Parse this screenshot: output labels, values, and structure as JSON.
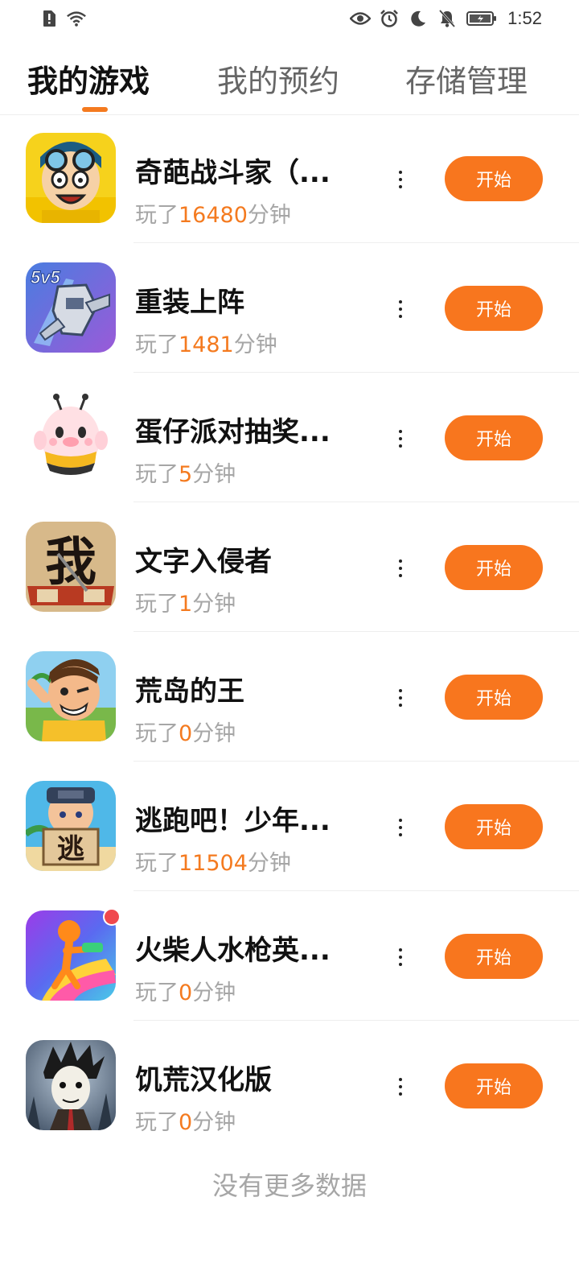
{
  "status_bar": {
    "time": "1:52",
    "left_icons": [
      "alert-sim-icon",
      "wifi-icon"
    ],
    "right_icons": [
      "eye-comfort-icon",
      "alarm-icon",
      "moon-icon",
      "mute-bell-icon",
      "battery-charging-icon"
    ]
  },
  "tabs": [
    {
      "label": "我的游戏",
      "active": true
    },
    {
      "label": "我的预约",
      "active": false
    },
    {
      "label": "存储管理",
      "active": false
    }
  ],
  "accent_color": "#f47a1f",
  "games": [
    {
      "title": "奇葩战斗家（...",
      "played_prefix": "玩了",
      "minutes": "16480",
      "played_suffix": "分钟",
      "button": "开始",
      "icon": "cartoon-boy-goggles-icon",
      "has_dot": false
    },
    {
      "title": "重装上阵",
      "played_prefix": "玩了",
      "minutes": "1481",
      "played_suffix": "分钟",
      "button": "开始",
      "icon": "robot-mech-5v5-icon",
      "has_dot": false
    },
    {
      "title": "蛋仔派对抽奖...",
      "played_prefix": "玩了",
      "minutes": "5",
      "played_suffix": "分钟",
      "button": "开始",
      "icon": "eggy-bee-icon",
      "has_dot": false
    },
    {
      "title": "文字入侵者",
      "played_prefix": "玩了",
      "minutes": "1",
      "played_suffix": "分钟",
      "button": "开始",
      "icon": "calligraphy-wo-icon",
      "has_dot": false
    },
    {
      "title": "荒岛的王",
      "played_prefix": "玩了",
      "minutes": "0",
      "played_suffix": "分钟",
      "button": "开始",
      "icon": "island-boy-icon",
      "has_dot": false
    },
    {
      "title": "逃跑吧！少年...",
      "played_prefix": "玩了",
      "minutes": "11504",
      "played_suffix": "分钟",
      "button": "开始",
      "icon": "escape-boy-sign-icon",
      "has_dot": false
    },
    {
      "title": "火柴人水枪英...",
      "played_prefix": "玩了",
      "minutes": "0",
      "played_suffix": "分钟",
      "button": "开始",
      "icon": "stickman-watergun-icon",
      "has_dot": true
    },
    {
      "title": "饥荒汉化版",
      "played_prefix": "玩了",
      "minutes": "0",
      "played_suffix": "分钟",
      "button": "开始",
      "icon": "dont-starve-wilson-icon",
      "has_dot": false
    }
  ],
  "icon_badge_text": {
    "mech": "5v5",
    "wo": "我",
    "escape": "逃"
  },
  "footer": "没有更多数据"
}
